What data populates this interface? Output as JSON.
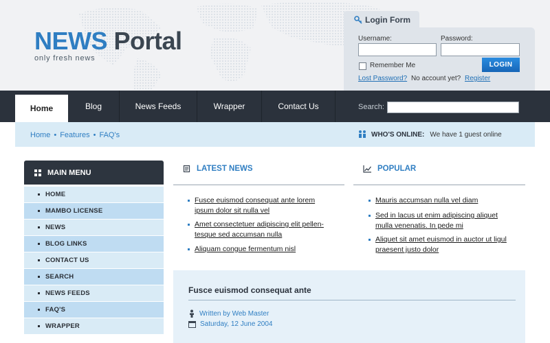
{
  "brand": {
    "name_part1": "NEWS",
    "name_part2": "Portal",
    "tagline": "only fresh news"
  },
  "login": {
    "title": "Login Form",
    "username_label": "Username:",
    "password_label": "Password:",
    "username_value": "",
    "password_value": "",
    "remember_label": "Remember Me",
    "remember_checked": false,
    "button_label": "LOGIN",
    "lost_password": "Lost Password?",
    "no_account": "No account yet?",
    "register": "Register"
  },
  "nav": {
    "items": [
      {
        "label": "Home",
        "active": true
      },
      {
        "label": "Blog"
      },
      {
        "label": "News Feeds"
      },
      {
        "label": "Wrapper"
      },
      {
        "label": "Contact Us"
      }
    ],
    "search_label": "Search:",
    "search_value": ""
  },
  "breadcrumb": [
    "Home",
    "Features",
    "FAQ's"
  ],
  "whos_online": {
    "label": "WHO'S ONLINE:",
    "text": "We have 1 guest online"
  },
  "sidebar": {
    "title": "MAIN MENU",
    "items": [
      "HOME",
      "MAMBO LICENSE",
      "NEWS",
      "BLOG LINKS",
      "CONTACT US",
      "SEARCH",
      "NEWS FEEDS",
      "FAQ'S",
      "WRAPPER"
    ]
  },
  "latest": {
    "title": "LATEST NEWS",
    "items": [
      {
        "line1": "Fusce euismod consequat ante lorem",
        "line2": "ipsum dolor sit  nulla vel"
      },
      {
        "line1": "Amet consectetuer adipiscing elit pellen-",
        "line2": "tesque sed accumsan nulla"
      },
      {
        "line1": "Aliquam congue fermentum nisl",
        "line2": ""
      }
    ]
  },
  "popular": {
    "title": "POPULAR",
    "items": [
      {
        "line1": "Mauris accumsan nulla vel diam",
        "line2": ""
      },
      {
        "line1": "Sed in lacus ut enim adipiscing aliquet",
        "line2": "mulla venenatis. In pede mi"
      },
      {
        "line1": "Aliquet sit amet euismod in auctor ut ligul",
        "line2": "praesent justo dolor"
      }
    ]
  },
  "article": {
    "title": "Fusce euismod consequat ante",
    "author": "Written by Web Master",
    "date": "Saturday, 12 June 2004"
  },
  "colors": {
    "accent": "#2f7ec2",
    "nav": "#2b323c",
    "menu_light": "#d9ebf6",
    "menu_dark": "#bfdcf2"
  },
  "icons": [
    "key-icon",
    "users-online-icon",
    "menu-icon",
    "news-icon",
    "chart-icon",
    "person-icon",
    "calendar-icon"
  ]
}
